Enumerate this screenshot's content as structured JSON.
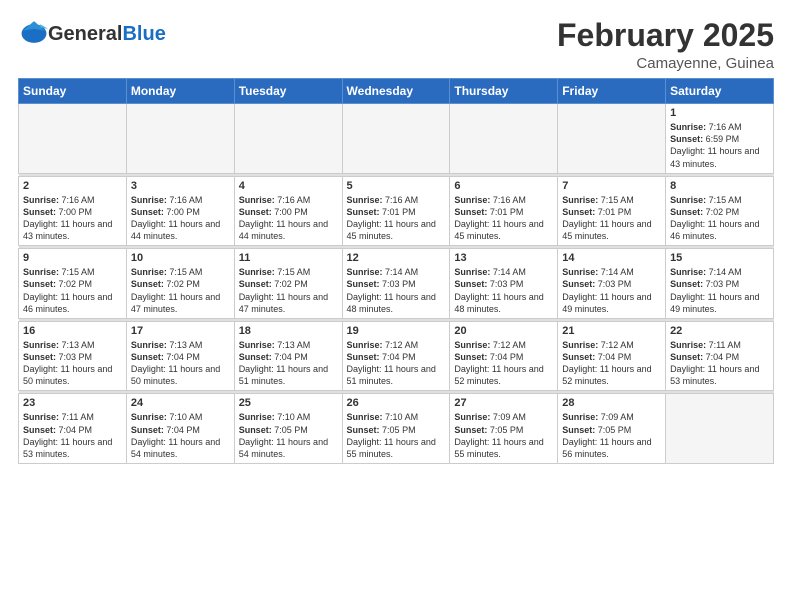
{
  "header": {
    "logo_general": "General",
    "logo_blue": "Blue",
    "month_title": "February 2025",
    "location": "Camayenne, Guinea"
  },
  "weekdays": [
    "Sunday",
    "Monday",
    "Tuesday",
    "Wednesday",
    "Thursday",
    "Friday",
    "Saturday"
  ],
  "weeks": [
    [
      {
        "day": "",
        "empty": true
      },
      {
        "day": "",
        "empty": true
      },
      {
        "day": "",
        "empty": true
      },
      {
        "day": "",
        "empty": true
      },
      {
        "day": "",
        "empty": true
      },
      {
        "day": "",
        "empty": true
      },
      {
        "day": "1",
        "sunrise": "7:16 AM",
        "sunset": "6:59 PM",
        "daylight": "11 hours and 43 minutes."
      }
    ],
    [
      {
        "day": "2",
        "sunrise": "7:16 AM",
        "sunset": "7:00 PM",
        "daylight": "11 hours and 43 minutes."
      },
      {
        "day": "3",
        "sunrise": "7:16 AM",
        "sunset": "7:00 PM",
        "daylight": "11 hours and 44 minutes."
      },
      {
        "day": "4",
        "sunrise": "7:16 AM",
        "sunset": "7:00 PM",
        "daylight": "11 hours and 44 minutes."
      },
      {
        "day": "5",
        "sunrise": "7:16 AM",
        "sunset": "7:01 PM",
        "daylight": "11 hours and 45 minutes."
      },
      {
        "day": "6",
        "sunrise": "7:16 AM",
        "sunset": "7:01 PM",
        "daylight": "11 hours and 45 minutes."
      },
      {
        "day": "7",
        "sunrise": "7:15 AM",
        "sunset": "7:01 PM",
        "daylight": "11 hours and 45 minutes."
      },
      {
        "day": "8",
        "sunrise": "7:15 AM",
        "sunset": "7:02 PM",
        "daylight": "11 hours and 46 minutes."
      }
    ],
    [
      {
        "day": "9",
        "sunrise": "7:15 AM",
        "sunset": "7:02 PM",
        "daylight": "11 hours and 46 minutes."
      },
      {
        "day": "10",
        "sunrise": "7:15 AM",
        "sunset": "7:02 PM",
        "daylight": "11 hours and 47 minutes."
      },
      {
        "day": "11",
        "sunrise": "7:15 AM",
        "sunset": "7:02 PM",
        "daylight": "11 hours and 47 minutes."
      },
      {
        "day": "12",
        "sunrise": "7:14 AM",
        "sunset": "7:03 PM",
        "daylight": "11 hours and 48 minutes."
      },
      {
        "day": "13",
        "sunrise": "7:14 AM",
        "sunset": "7:03 PM",
        "daylight": "11 hours and 48 minutes."
      },
      {
        "day": "14",
        "sunrise": "7:14 AM",
        "sunset": "7:03 PM",
        "daylight": "11 hours and 49 minutes."
      },
      {
        "day": "15",
        "sunrise": "7:14 AM",
        "sunset": "7:03 PM",
        "daylight": "11 hours and 49 minutes."
      }
    ],
    [
      {
        "day": "16",
        "sunrise": "7:13 AM",
        "sunset": "7:03 PM",
        "daylight": "11 hours and 50 minutes."
      },
      {
        "day": "17",
        "sunrise": "7:13 AM",
        "sunset": "7:04 PM",
        "daylight": "11 hours and 50 minutes."
      },
      {
        "day": "18",
        "sunrise": "7:13 AM",
        "sunset": "7:04 PM",
        "daylight": "11 hours and 51 minutes."
      },
      {
        "day": "19",
        "sunrise": "7:12 AM",
        "sunset": "7:04 PM",
        "daylight": "11 hours and 51 minutes."
      },
      {
        "day": "20",
        "sunrise": "7:12 AM",
        "sunset": "7:04 PM",
        "daylight": "11 hours and 52 minutes."
      },
      {
        "day": "21",
        "sunrise": "7:12 AM",
        "sunset": "7:04 PM",
        "daylight": "11 hours and 52 minutes."
      },
      {
        "day": "22",
        "sunrise": "7:11 AM",
        "sunset": "7:04 PM",
        "daylight": "11 hours and 53 minutes."
      }
    ],
    [
      {
        "day": "23",
        "sunrise": "7:11 AM",
        "sunset": "7:04 PM",
        "daylight": "11 hours and 53 minutes."
      },
      {
        "day": "24",
        "sunrise": "7:10 AM",
        "sunset": "7:04 PM",
        "daylight": "11 hours and 54 minutes."
      },
      {
        "day": "25",
        "sunrise": "7:10 AM",
        "sunset": "7:05 PM",
        "daylight": "11 hours and 54 minutes."
      },
      {
        "day": "26",
        "sunrise": "7:10 AM",
        "sunset": "7:05 PM",
        "daylight": "11 hours and 55 minutes."
      },
      {
        "day": "27",
        "sunrise": "7:09 AM",
        "sunset": "7:05 PM",
        "daylight": "11 hours and 55 minutes."
      },
      {
        "day": "28",
        "sunrise": "7:09 AM",
        "sunset": "7:05 PM",
        "daylight": "11 hours and 56 minutes."
      },
      {
        "day": "",
        "empty": true
      }
    ]
  ],
  "labels": {
    "sunrise": "Sunrise:",
    "sunset": "Sunset:",
    "daylight": "Daylight hours"
  }
}
